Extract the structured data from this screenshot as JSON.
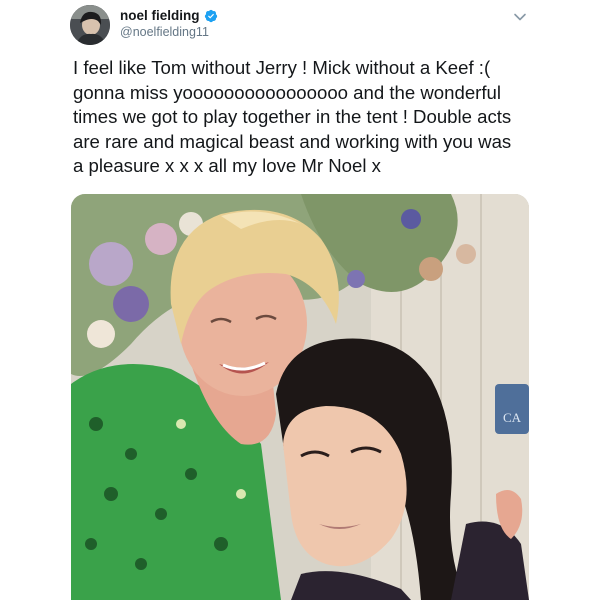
{
  "author": {
    "display_name": "noel fielding",
    "handle": "@noelfielding11",
    "verified": true,
    "avatar_icon": "avatar-photo"
  },
  "tweet": {
    "text": "I feel like Tom without Jerry ! Mick without a Keef :(\ngonna miss yoooooooooooooooo and the wonderful\ntimes we got to play together in the tent ! Double acts\nare rare and magical beast   and working with you was\na pleasure x x x all my love Mr Noel x"
  },
  "photo": {
    "sign_text": "CA"
  },
  "icons": {
    "verified": "verified-badge-icon",
    "menu": "chevron-down-icon"
  },
  "colors": {
    "verified": "#1da1f2",
    "handle": "#657786",
    "text": "#14171a"
  }
}
